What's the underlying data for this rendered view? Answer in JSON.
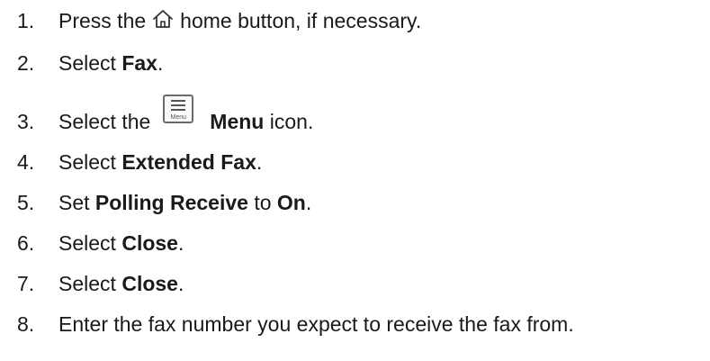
{
  "steps": [
    {
      "num": "1.",
      "a": "Press the",
      "icon": "home-icon",
      "b": "home button, if necessary."
    },
    {
      "num": "2.",
      "a": "Select ",
      "bold1": "Fax",
      "b": "."
    },
    {
      "num": "3.",
      "a": "Select the",
      "icon": "menu-icon",
      "icon_label": "Menu",
      "bold1": "Menu",
      "b": " icon."
    },
    {
      "num": "4.",
      "a": "Select ",
      "bold1": "Extended Fax",
      "b": "."
    },
    {
      "num": "5.",
      "a": "Set ",
      "bold1": "Polling Receive",
      "mid": " to ",
      "bold2": "On",
      "b": "."
    },
    {
      "num": "6.",
      "a": "Select ",
      "bold1": "Close",
      "b": "."
    },
    {
      "num": "7.",
      "a": "Select ",
      "bold1": "Close",
      "b": "."
    },
    {
      "num": "8.",
      "a": "Enter the fax number you expect to receive the fax from."
    }
  ]
}
